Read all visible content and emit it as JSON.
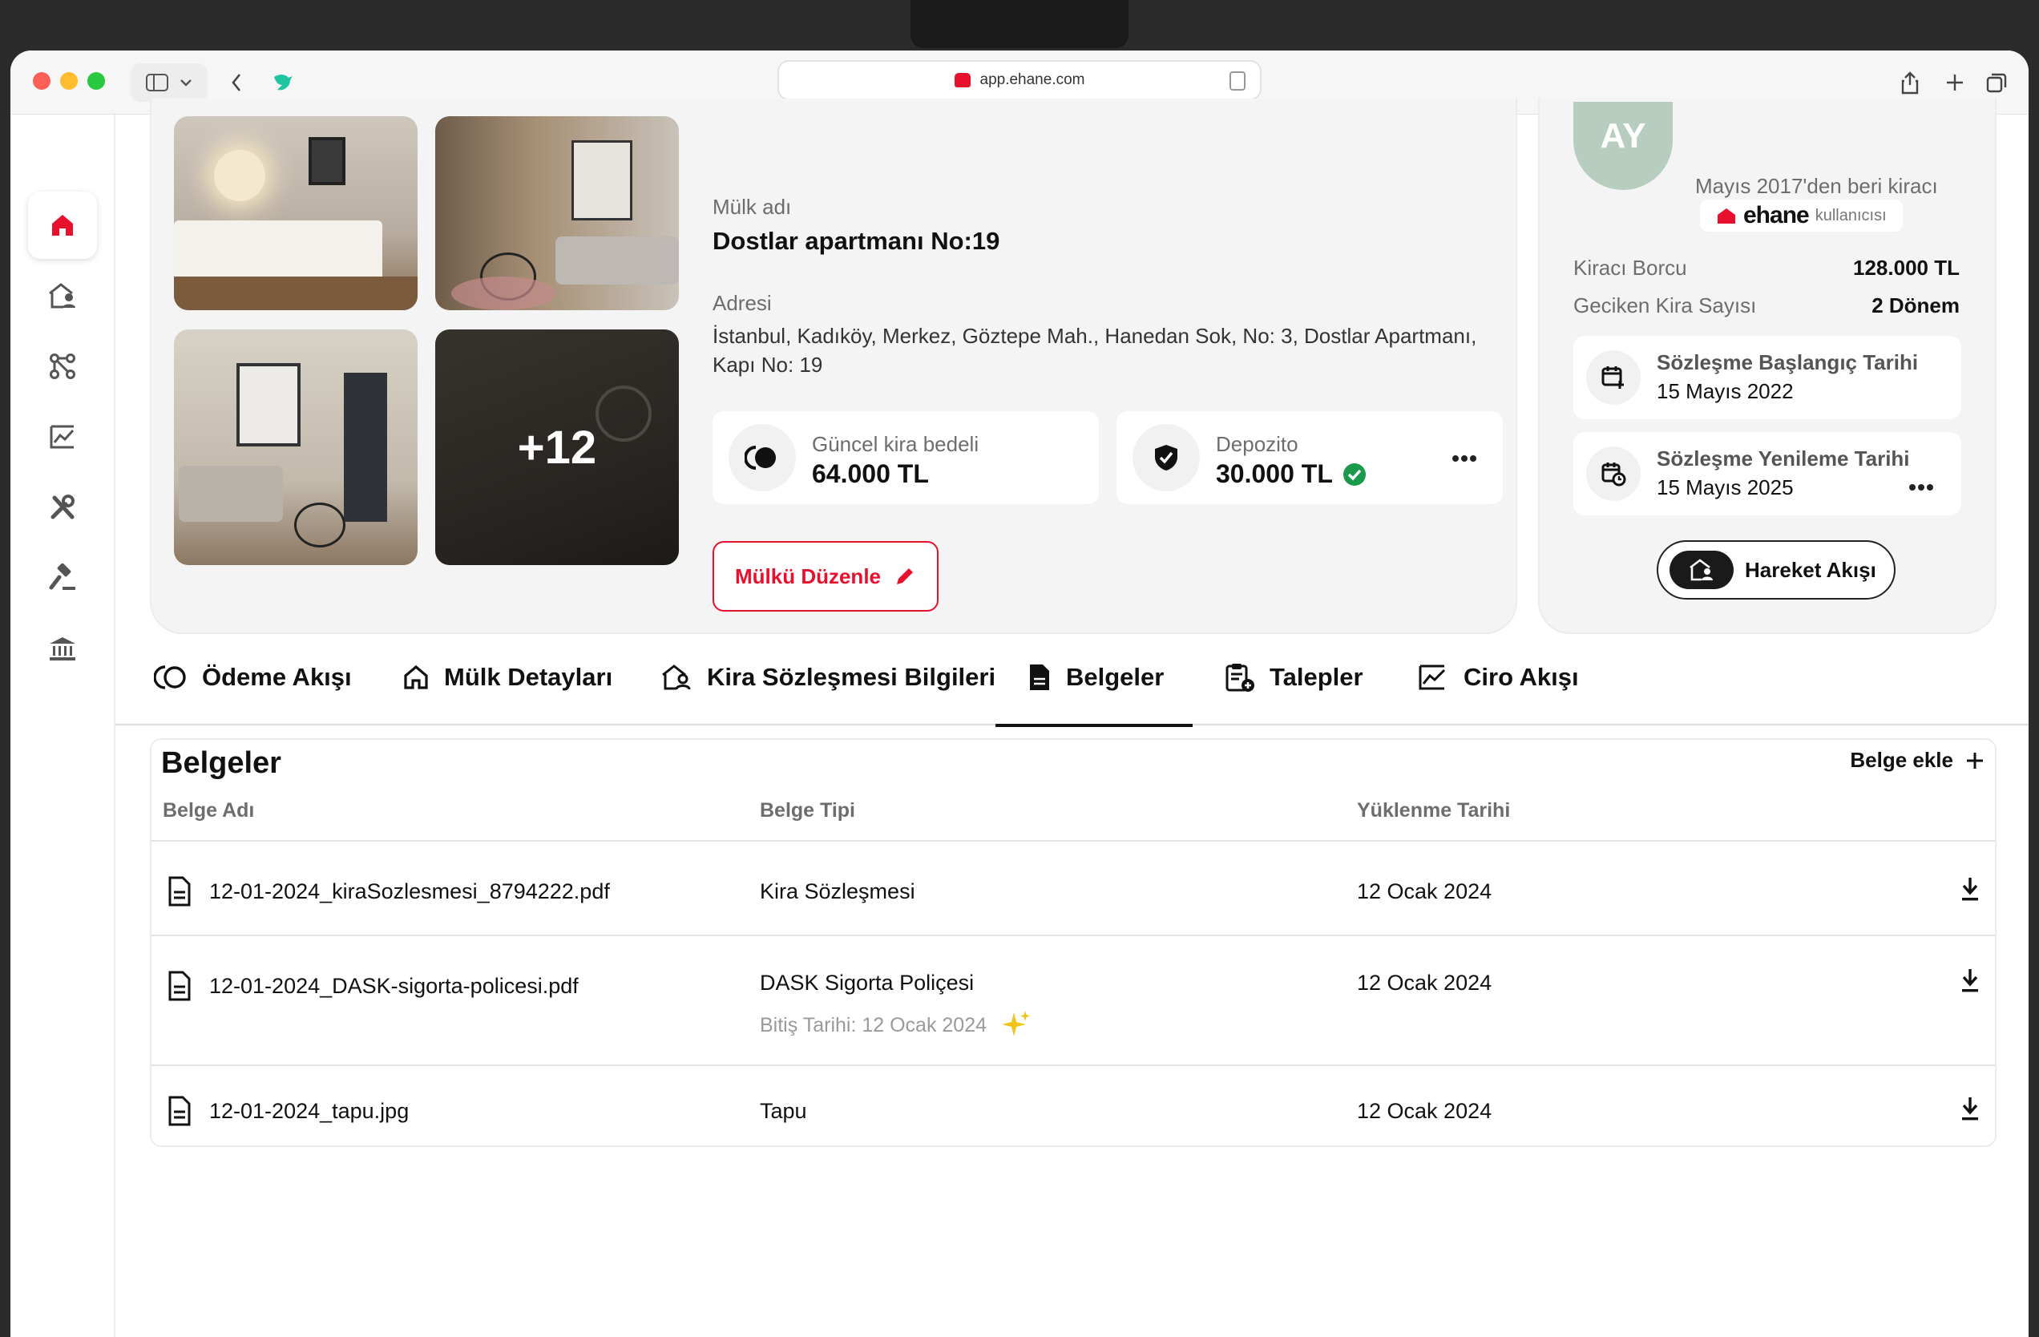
{
  "browser": {
    "url": "app.ehane.com"
  },
  "property": {
    "name_label": "Mülk adı",
    "name": "Dostlar apartmanı No:19",
    "address_label": "Adresi",
    "address": "İstanbul, Kadıköy, Merkez, Göztepe Mah., Hanedan Sok, No: 3, Dostlar Apartmanı, Kapı No: 19",
    "more_photos": "+12",
    "rent_label": "Güncel kira bedeli",
    "rent_value": "64.000 TL",
    "deposit_label": "Depozito",
    "deposit_value": "30.000 TL",
    "edit_label": "Mülkü Düzenle"
  },
  "tenant": {
    "initials": "AY",
    "since": "Mayıs 2017'den beri kiracı",
    "brand": "ehane",
    "brand_sub": "kullanıcısı",
    "debt_label": "Kiracı Borcu",
    "debt_value": "128.000 TL",
    "late_label": "Geciken Kira Sayısı",
    "late_value": "2 Dönem",
    "start_label": "Sözleşme Başlangıç Tarihi",
    "start_value": "15 Mayıs 2022",
    "renew_label": "Sözleşme Yenileme Tarihi",
    "renew_value": "15 Mayıs 2025",
    "activity_label": "Hareket Akışı"
  },
  "tabs": [
    {
      "label": "Ödeme Akışı"
    },
    {
      "label": "Mülk Detayları"
    },
    {
      "label": "Kira Sözleşmesi Bilgileri"
    },
    {
      "label": "Belgeler"
    },
    {
      "label": "Talepler"
    },
    {
      "label": "Ciro Akışı"
    }
  ],
  "documents": {
    "title": "Belgeler",
    "add_label": "Belge ekle",
    "columns": [
      "Belge Adı",
      "Belge Tipi",
      "Yüklenme Tarihi"
    ],
    "rows": [
      {
        "name": "12-01-2024_kiraSozlesmesi_8794222.pdf",
        "type": "Kira Sözleşmesi",
        "date": "12 Ocak 2024"
      },
      {
        "name": "12-01-2024_DASK-sigorta-policesi.pdf",
        "type": "DASK Sigorta Poliçesi",
        "sub": "Bitiş Tarihi: 12 Ocak 2024",
        "date": "12 Ocak 2024"
      },
      {
        "name": "12-01-2024_tapu.jpg",
        "type": "Tapu",
        "date": "12 Ocak 2024"
      }
    ]
  },
  "colors": {
    "brand_red": "#e8112d",
    "success_green": "#1a9a4b",
    "sparkle_yellow": "#f2c318"
  }
}
